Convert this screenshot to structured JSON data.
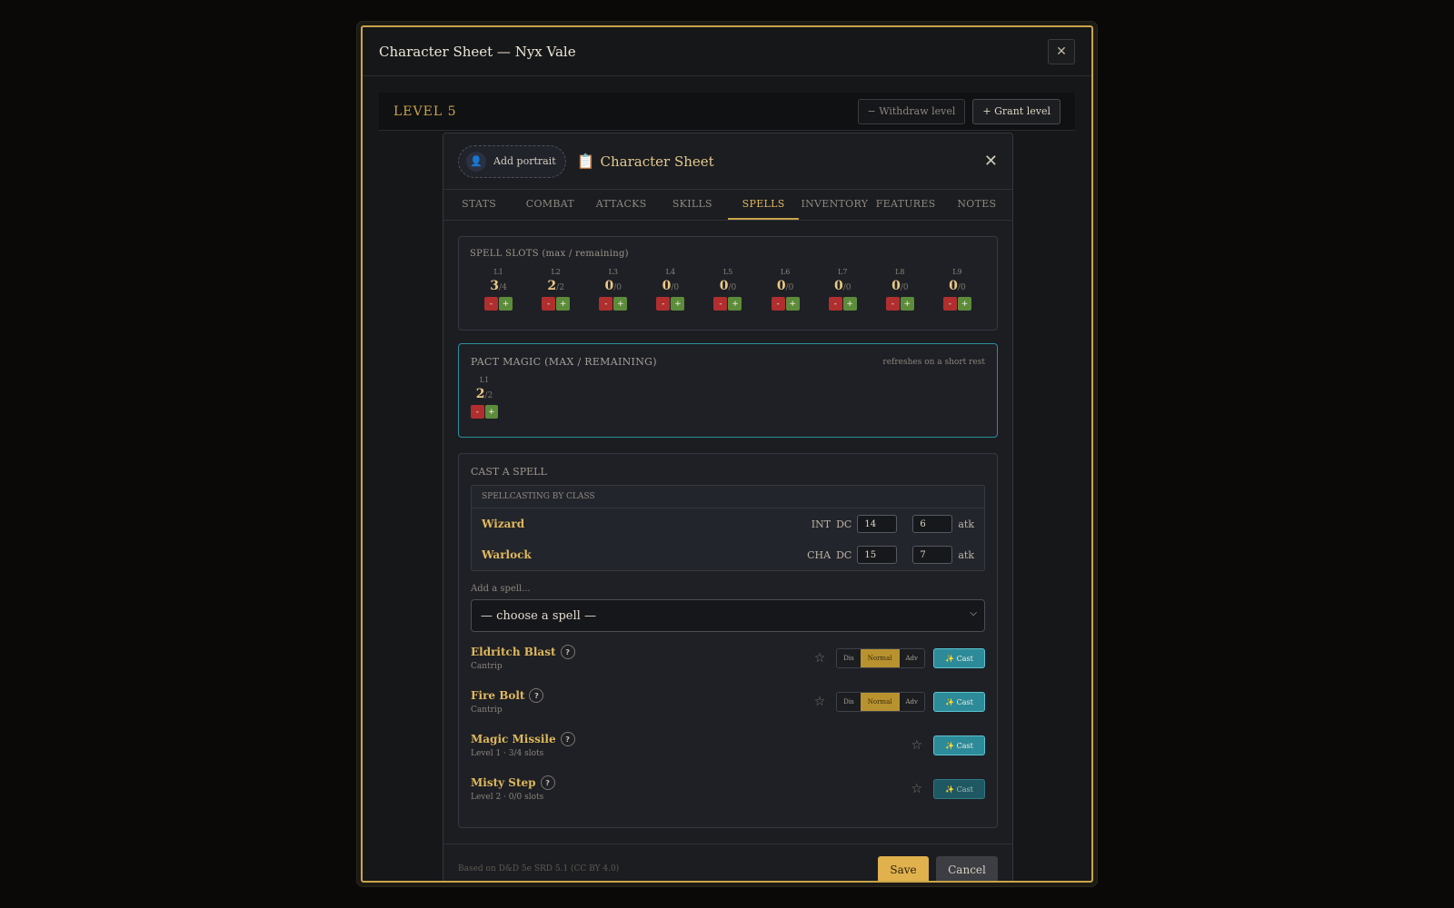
{
  "outer": {
    "title": "Character Sheet — Nyx Vale",
    "close": "✕",
    "level_label": "LEVEL 5",
    "withdraw_label": "− Withdraw level",
    "grant_label": "+ Grant level"
  },
  "sheet": {
    "portrait_label": "Add portrait",
    "portrait_icon": "👤",
    "title_icon": "📋",
    "title": "Character Sheet",
    "close": "✕",
    "tabs": [
      "STATS",
      "COMBAT",
      "ATTACKS",
      "SKILLS",
      "SPELLS",
      "INVENTORY",
      "FEATURES",
      "NOTES"
    ],
    "active_tab": "SPELLS"
  },
  "slots": {
    "title": "SPELL SLOTS (max / remaining)",
    "levels": [
      {
        "label": "L1",
        "value": "3",
        "max": "/4"
      },
      {
        "label": "L2",
        "value": "2",
        "max": "/2"
      },
      {
        "label": "L3",
        "value": "0",
        "max": "/0"
      },
      {
        "label": "L4",
        "value": "0",
        "max": "/0"
      },
      {
        "label": "L5",
        "value": "0",
        "max": "/0"
      },
      {
        "label": "L6",
        "value": "0",
        "max": "/0"
      },
      {
        "label": "L7",
        "value": "0",
        "max": "/0"
      },
      {
        "label": "L8",
        "value": "0",
        "max": "/0"
      },
      {
        "label": "L9",
        "value": "0",
        "max": "/0"
      }
    ],
    "minus": "-",
    "plus": "+"
  },
  "pact": {
    "title": "PACT MAGIC (MAX / REMAINING)",
    "note": "refreshes on a short rest",
    "label": "L1",
    "value": "2",
    "max": "/2"
  },
  "cast": {
    "title": "CAST A SPELL",
    "class_header": "SPELLCASTING BY CLASS",
    "dc_label": "DC",
    "atk_label": "atk",
    "classes": [
      {
        "name": "Wizard",
        "ability": "INT",
        "dc": "14",
        "atk": "6"
      },
      {
        "name": "Warlock",
        "ability": "CHA",
        "dc": "15",
        "atk": "7"
      }
    ],
    "add_label": "Add a spell...",
    "select_value": "— choose a spell —",
    "dis": "Dis",
    "normal": "Normal",
    "adv": "Adv",
    "cast_label": "✨ Cast",
    "help": "?",
    "star": "☆",
    "spells": [
      {
        "name": "Eldritch Blast",
        "sub": "Cantrip"
      },
      {
        "name": "Fire Bolt",
        "sub": "Cantrip"
      },
      {
        "name": "Magic Missile",
        "sub": "Level 1 · 3/4 slots"
      },
      {
        "name": "Misty Step",
        "sub": "Level 2 · 0/0 slots"
      }
    ]
  },
  "footer": {
    "license": "Based on D&D 5e SRD 5.1 (CC BY 4.0)",
    "save": "Save",
    "cancel": "Cancel"
  },
  "colors": {
    "accent_gold": "#c9a54a",
    "cast_teal": "#2d8b99",
    "minus_red": "#b02e2e",
    "plus_green": "#5c8c3a"
  }
}
